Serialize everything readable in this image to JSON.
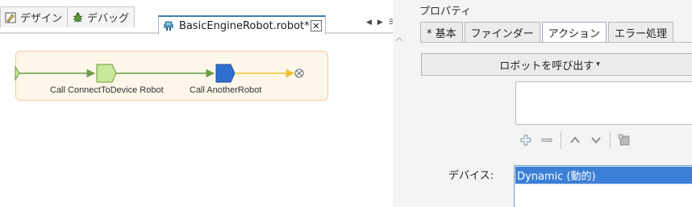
{
  "left": {
    "view_tabs": [
      {
        "label": "デザイン",
        "icon": "design-icon"
      },
      {
        "label": "デバッグ",
        "icon": "bug-icon"
      }
    ],
    "editor_tab": {
      "label": "BasicEngineRobot.robot*",
      "icon": "robot-file-icon",
      "close_glyph": "✕"
    },
    "tab_controls": {
      "left": "◀",
      "right": "▶",
      "list": "☰"
    },
    "flow": {
      "steps": [
        {
          "label": "Call ConnectToDevice Robot",
          "color": "#c9e89a"
        },
        {
          "label": "Call AnotherRobot",
          "color": "#2f6fd0"
        }
      ],
      "connector_color": "#6e9b45",
      "end_connector_color": "#f0c030"
    }
  },
  "properties": {
    "title": "プロパティ",
    "tabs": [
      "* 基本",
      "ファインダー",
      "アクション",
      "エラー処理"
    ],
    "active_tab": "アクション",
    "invoke_button": "ロボットを呼び出す",
    "invoke_caret": "▾",
    "toolbar": [
      {
        "name": "add-icon"
      },
      {
        "name": "remove-icon"
      },
      {
        "name": "move-up-icon"
      },
      {
        "name": "move-down-icon"
      },
      {
        "name": "edit-icon"
      }
    ],
    "device_label": "デバイス:",
    "device_value": "Dynamic (動的)"
  },
  "colors": {
    "selection": "#3b7fd6",
    "active_tab_border": "#3c7fb1"
  }
}
